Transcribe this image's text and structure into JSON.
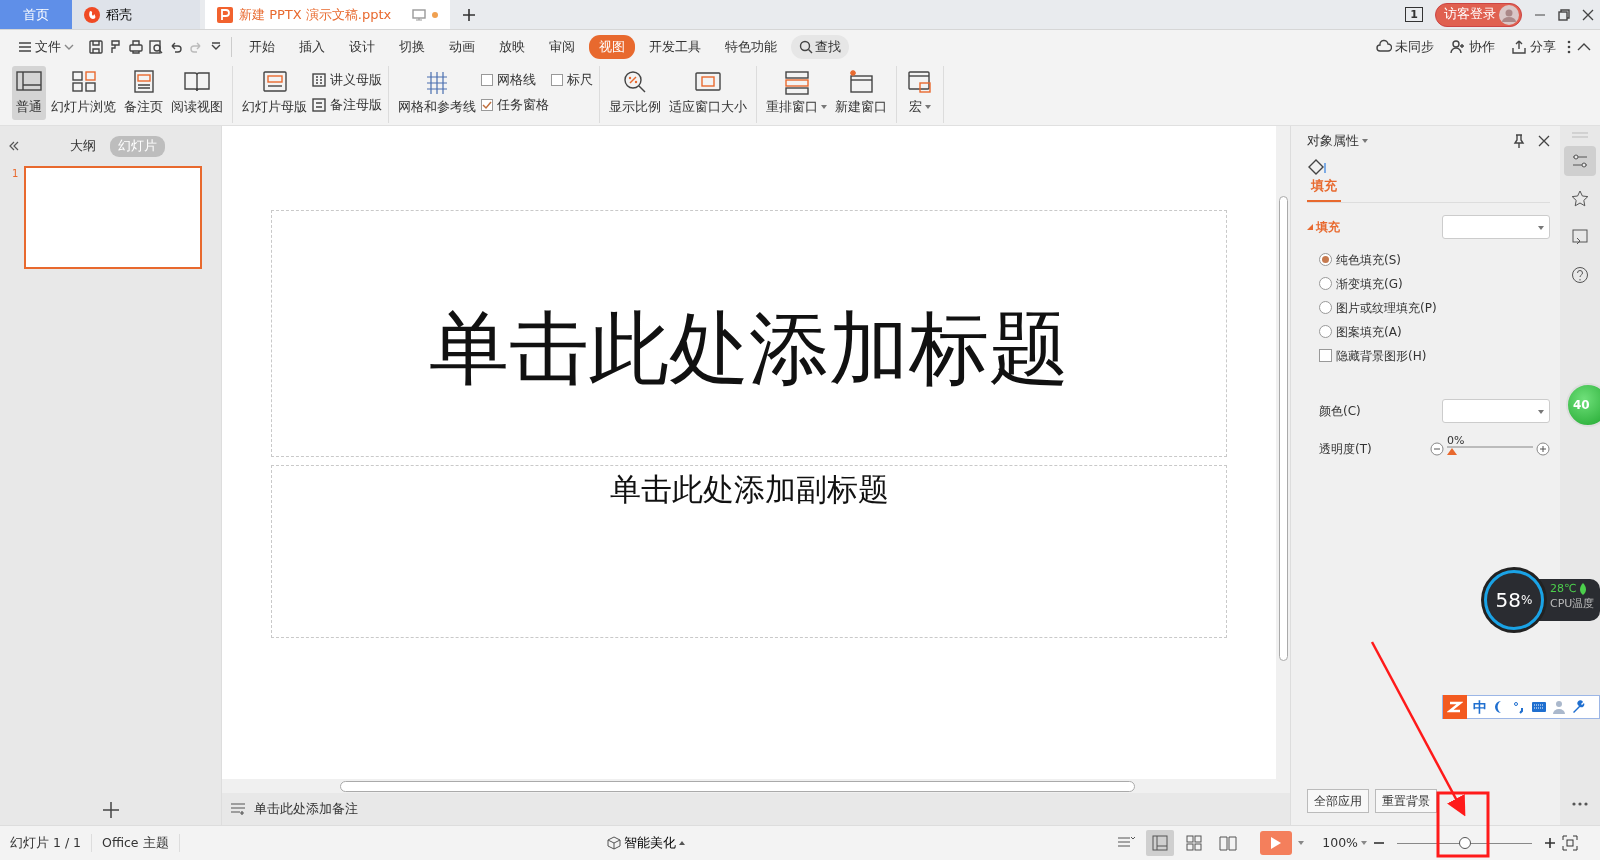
{
  "tabs": [
    {
      "label": "首页",
      "kind": "home",
      "selected": false
    },
    {
      "label": "稻壳",
      "kind": "app",
      "selected": false
    },
    {
      "label": "新建 PPTX 演示文稿.pptx",
      "kind": "doc",
      "selected": true
    }
  ],
  "title_bar": {
    "window_count": "1",
    "login": "访客登录"
  },
  "menu": {
    "file": "文件",
    "items": [
      {
        "label": "开始",
        "selected": false
      },
      {
        "label": "插入",
        "selected": false
      },
      {
        "label": "设计",
        "selected": false
      },
      {
        "label": "切换",
        "selected": false
      },
      {
        "label": "动画",
        "selected": false
      },
      {
        "label": "放映",
        "selected": false
      },
      {
        "label": "审阅",
        "selected": false
      },
      {
        "label": "视图",
        "selected": true
      },
      {
        "label": "开发工具",
        "selected": false
      },
      {
        "label": "特色功能",
        "selected": false
      }
    ],
    "search": "查找",
    "actions": [
      "未同步",
      "协作",
      "分享"
    ]
  },
  "ribbon_groups": [
    [
      {
        "kind": "big",
        "label": "普通",
        "selected": true
      },
      {
        "kind": "big",
        "label": "幻灯片浏览",
        "selected": false
      },
      {
        "kind": "big",
        "label": "备注页",
        "selected": false
      },
      {
        "kind": "big",
        "label": "阅读视图",
        "selected": false
      }
    ],
    [
      {
        "kind": "big",
        "label": "幻灯片母版",
        "selected": false
      },
      {
        "kind": "stack",
        "items": [
          {
            "kind": "small",
            "label": "讲义母版"
          },
          {
            "kind": "small",
            "label": "备注母版"
          }
        ]
      }
    ],
    [
      {
        "kind": "big",
        "label": "网格和参考线",
        "selected": false
      },
      {
        "kind": "stack",
        "items": [
          {
            "kind": "check",
            "label": "网格线",
            "checked": false
          },
          {
            "kind": "check",
            "label": "任务窗格",
            "checked": true
          }
        ]
      },
      {
        "kind": "stack",
        "items": [
          {
            "kind": "check",
            "label": "标尺",
            "checked": false
          }
        ]
      }
    ],
    [
      {
        "kind": "big",
        "label": "显示比例",
        "selected": false
      },
      {
        "kind": "big",
        "label": "适应窗口大小",
        "selected": false
      }
    ],
    [
      {
        "kind": "big",
        "label": "重排窗口",
        "selected": false,
        "dropdown": true
      },
      {
        "kind": "big",
        "label": "新建窗口",
        "selected": false
      }
    ],
    [
      {
        "kind": "big",
        "label": "宏",
        "selected": false,
        "dropdown": true
      }
    ]
  ],
  "slide_panel": {
    "tabs": [
      {
        "label": "大纲",
        "selected": false
      },
      {
        "label": "幻灯片",
        "selected": true
      }
    ],
    "slides": [
      {
        "number": "1",
        "selected": true
      }
    ]
  },
  "slide": {
    "title": "单击此处添加标题",
    "subtitle": "单击此处添加副标题"
  },
  "notes": "单击此处添加备注",
  "properties": {
    "title": "对象属性",
    "tab": {
      "label": "填充",
      "selected": true
    },
    "section": "填充",
    "options": [
      {
        "kind": "radio",
        "label": "纯色填充(S)",
        "selected": true
      },
      {
        "kind": "radio",
        "label": "渐变填充(G)",
        "selected": false
      },
      {
        "kind": "radio",
        "label": "图片或纹理填充(P)",
        "selected": false
      },
      {
        "kind": "radio",
        "label": "图案填充(A)",
        "selected": false
      },
      {
        "kind": "check",
        "label": "隐藏背景图形(H)",
        "checked": false
      }
    ],
    "color_label": "颜色(C)",
    "transparency_label": "透明度(T)",
    "transparency": {
      "reading": "0%",
      "level": 0
    },
    "buttons": [
      "全部应用",
      "重置背景"
    ]
  },
  "status_bar": {
    "slide": "幻灯片 1 / 1",
    "theme": "Office 主题",
    "beautify": "智能美化",
    "views": [
      {
        "selected": false
      },
      {
        "selected": true
      },
      {
        "selected": false
      },
      {
        "selected": false
      }
    ],
    "zoom": "100%",
    "zoom_slider": {
      "level": 0.5
    }
  },
  "widgets": {
    "ball": "40",
    "cpu_usage": "58",
    "cpu_unit": "%",
    "cpu_temp": "28℃",
    "cpu_label": "CPU温度",
    "ime": "中"
  }
}
